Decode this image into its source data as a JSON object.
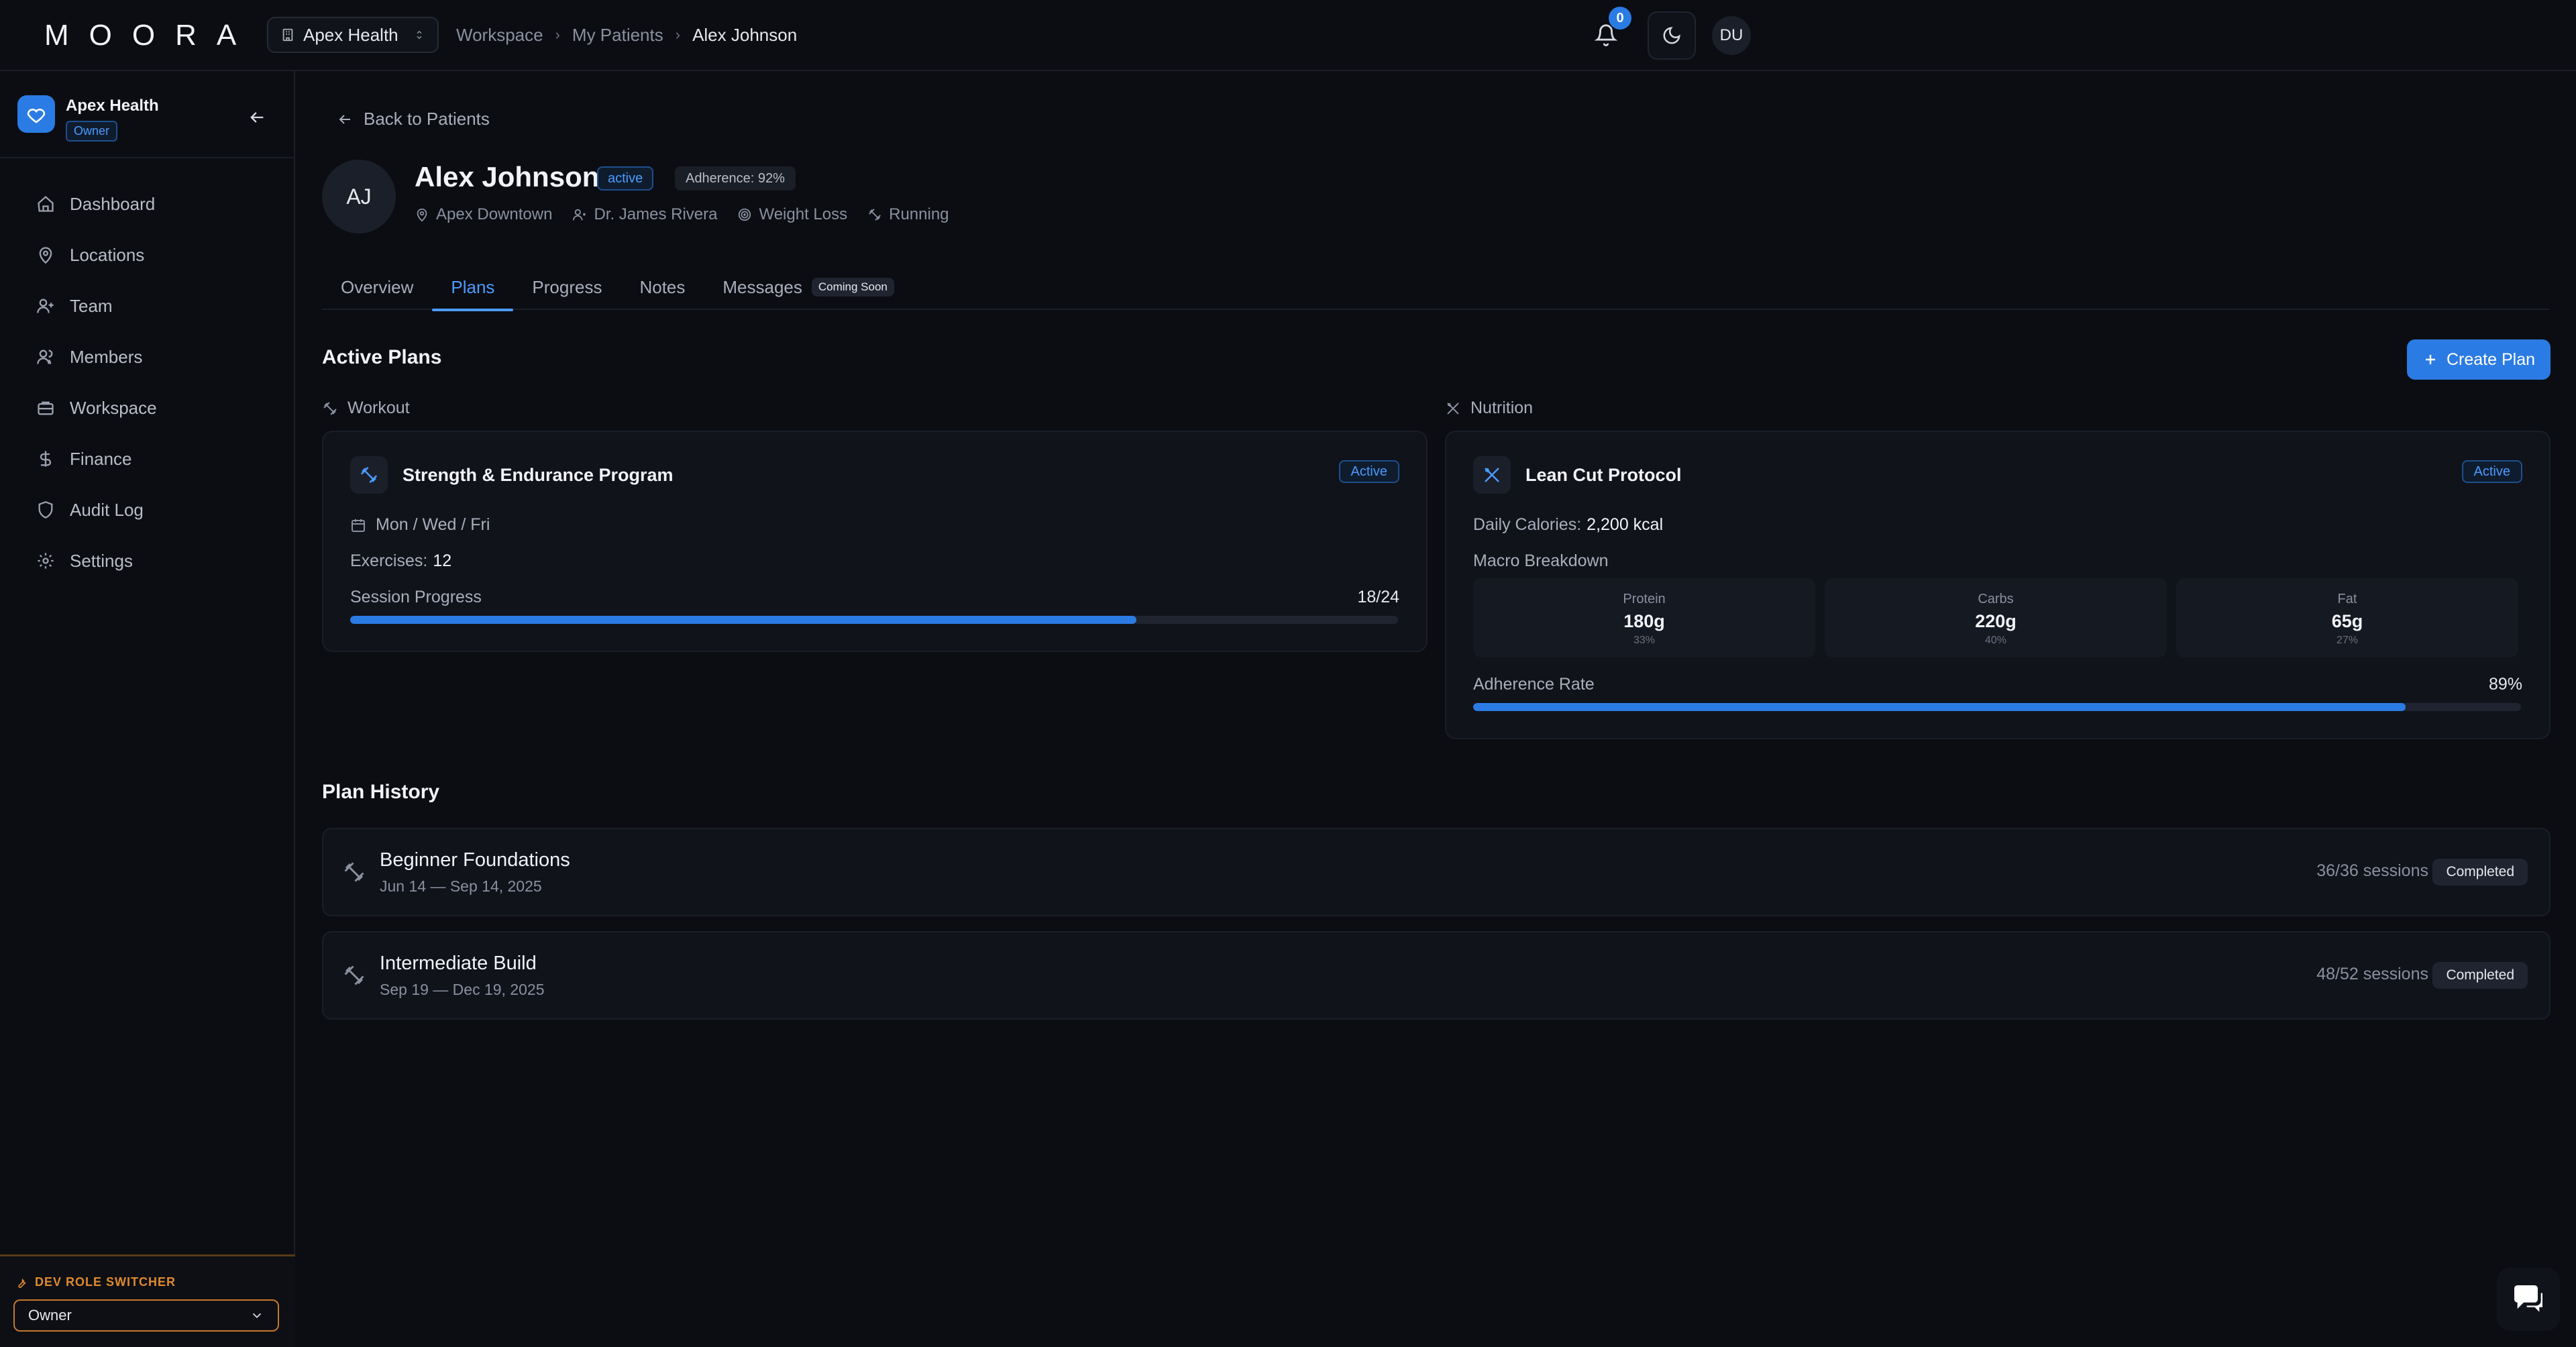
{
  "app": {
    "logo_text": "MOORA"
  },
  "topbar": {
    "org_name": "Apex Health",
    "breadcrumbs": [
      "Workspace",
      "My Patients",
      "Alex Johnson"
    ],
    "notifications_count": "0",
    "user_initials": "DU"
  },
  "sidebar": {
    "org_name": "Apex Health",
    "org_role": "Owner",
    "items": [
      {
        "label": "Dashboard",
        "icon": "home-icon"
      },
      {
        "label": "Locations",
        "icon": "map-pin-icon"
      },
      {
        "label": "Team",
        "icon": "user-plus-icon"
      },
      {
        "label": "Members",
        "icon": "users-icon"
      },
      {
        "label": "Workspace",
        "icon": "briefcase-icon"
      },
      {
        "label": "Finance",
        "icon": "dollar-icon"
      },
      {
        "label": "Audit Log",
        "icon": "shield-icon"
      },
      {
        "label": "Settings",
        "icon": "gear-icon"
      }
    ],
    "dev_switcher_label": "DEV ROLE SWITCHER",
    "dev_switcher_value": "Owner"
  },
  "patient": {
    "back_label": "Back to Patients",
    "initials": "AJ",
    "name": "Alex Johnson",
    "status": "active",
    "adherence": "Adherence: 92%",
    "location": "Apex Downtown",
    "doctor": "Dr. James Rivera",
    "goal": "Weight Loss",
    "activity": "Running"
  },
  "tabs": [
    {
      "label": "Overview"
    },
    {
      "label": "Plans"
    },
    {
      "label": "Progress"
    },
    {
      "label": "Notes"
    },
    {
      "label": "Messages",
      "badge": "Coming Soon"
    }
  ],
  "active_tab": "Plans",
  "active_plans": {
    "title": "Active Plans",
    "create_label": "Create Plan",
    "workout": {
      "section_label": "Workout",
      "name": "Strength & Endurance Program",
      "status": "Active",
      "schedule": "Mon / Wed / Fri",
      "exercises_label": "Exercises:",
      "exercises_value": "12",
      "progress_label": "Session Progress",
      "progress_text": "18/24",
      "progress_fraction": 0.75
    },
    "nutrition": {
      "section_label": "Nutrition",
      "name": "Lean Cut Protocol",
      "status": "Active",
      "calories_label": "Daily Calories:",
      "calories_value": "2,200 kcal",
      "macro_label": "Macro Breakdown",
      "macros": [
        {
          "label": "Protein",
          "value": "180g",
          "pct": "33%"
        },
        {
          "label": "Carbs",
          "value": "220g",
          "pct": "40%"
        },
        {
          "label": "Fat",
          "value": "65g",
          "pct": "27%"
        }
      ],
      "adherence_label": "Adherence Rate",
      "adherence_text": "89%",
      "adherence_fraction": 0.89
    }
  },
  "plan_history": {
    "title": "Plan History",
    "items": [
      {
        "name": "Beginner Foundations",
        "dates": "Jun 14 — Sep 14, 2025",
        "sessions": "36/36 sessions",
        "status": "Completed"
      },
      {
        "name": "Intermediate Build",
        "dates": "Sep 19 — Dec 19, 2025",
        "sessions": "48/52 sessions",
        "status": "Completed"
      }
    ]
  },
  "colors": {
    "accent": "#2b7be4",
    "background": "#0b0d12",
    "card": "#10131a",
    "dev_orange": "#e08a2e"
  }
}
